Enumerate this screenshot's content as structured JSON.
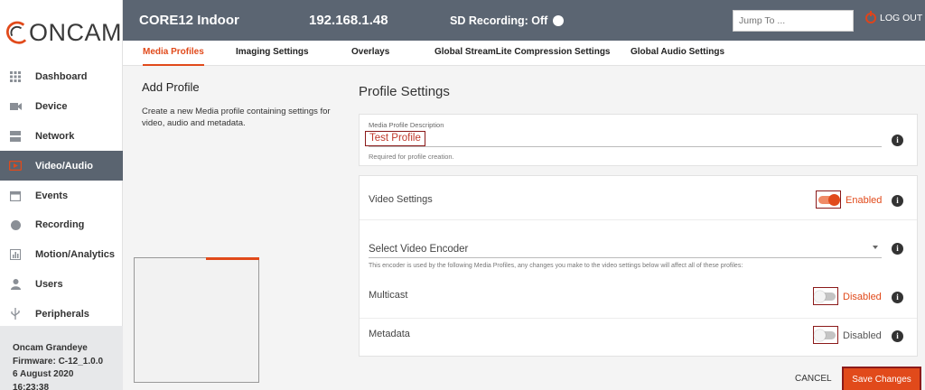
{
  "logo": {
    "text": "ONCAM"
  },
  "header": {
    "device_name": "CORE12 Indoor",
    "ip": "192.168.1.48",
    "sd_recording": "SD Recording: Off",
    "jump_placeholder": "Jump To ...",
    "logout": "LOG OUT"
  },
  "tabs": [
    {
      "label": "Media Profiles"
    },
    {
      "label": "Imaging Settings"
    },
    {
      "label": "Overlays"
    },
    {
      "label": "Global StreamLite Compression Settings"
    },
    {
      "label": "Global Audio Settings"
    }
  ],
  "sidebar": {
    "items": [
      {
        "label": "Dashboard",
        "icon": "grid-icon"
      },
      {
        "label": "Device",
        "icon": "camera-icon"
      },
      {
        "label": "Network",
        "icon": "network-icon"
      },
      {
        "label": "Video/Audio",
        "icon": "video-icon"
      },
      {
        "label": "Events",
        "icon": "calendar-icon"
      },
      {
        "label": "Recording",
        "icon": "record-icon"
      },
      {
        "label": "Motion/Analytics",
        "icon": "chart-icon"
      },
      {
        "label": "Users",
        "icon": "user-icon"
      },
      {
        "label": "Peripherals",
        "icon": "usb-icon"
      }
    ],
    "footer": {
      "line1": "Oncam Grandeye",
      "line2": "Firmware: C-12_1.0.0",
      "line3": "6 August 2020",
      "line4": "16:23:38"
    }
  },
  "left_panel": {
    "title": "Add Profile",
    "description": "Create a new Media profile containing settings for video, audio and metadata."
  },
  "profile_settings": {
    "title": "Profile Settings",
    "description_label": "Media Profile Description",
    "description_value": "Test Profile",
    "description_hint": "Required for profile creation.",
    "video_settings_label": "Video Settings",
    "video_settings_state": "Enabled",
    "encoder_label": "Select Video Encoder",
    "encoder_hint": "This encoder is used by the following Media Profiles, any changes you make to the video settings below will affect all of these profiles:",
    "multicast_label": "Multicast",
    "multicast_state": "Disabled",
    "metadata_label": "Metadata",
    "metadata_state": "Disabled"
  },
  "actions": {
    "cancel": "CANCEL",
    "save": "Save Changes"
  },
  "colors": {
    "accent": "#e14a1b",
    "topbar": "#5b6572",
    "sidebar_active": "#5a6470"
  }
}
